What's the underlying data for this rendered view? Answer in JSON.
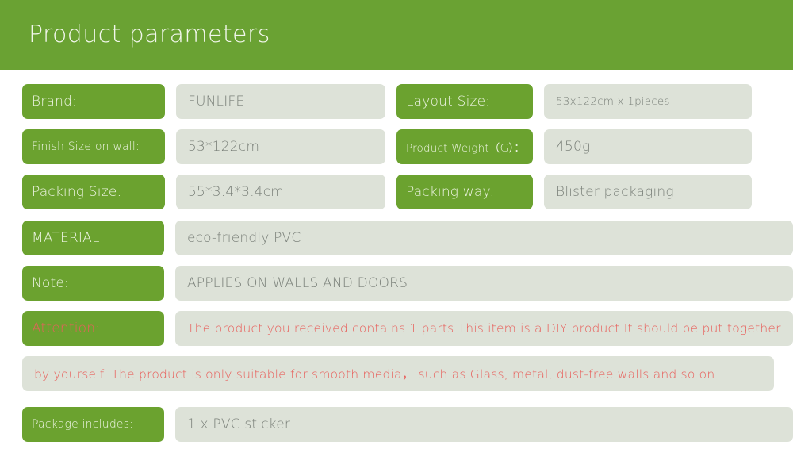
{
  "header": {
    "title": "Product parameters"
  },
  "colors": {
    "header_green": "#6aa233",
    "label_green": "#6ba22f",
    "value_gray": "#dde2d8",
    "value_text": "#7b817a",
    "label_text": "#eef5e4",
    "attention_red": "#e8605c",
    "page_background": "#ffffff"
  },
  "rows": [
    {
      "left": {
        "label": "Brand:",
        "value": "FUNLIFE"
      },
      "right": {
        "label": "Layout Size:",
        "value": "53x122cm x 1pieces"
      }
    },
    {
      "left": {
        "label": "Finish Size on wall:",
        "value": "53*122cm"
      },
      "right": {
        "label": "Product Weight（G）：",
        "value": "450g"
      }
    },
    {
      "left": {
        "label": "Packing Size:",
        "value": "55*3.4*3.4cm"
      },
      "right": {
        "label": "Packing way:",
        "value": "Blister packaging"
      }
    }
  ],
  "wide_rows": [
    {
      "label": "MATERIAL:",
      "value": "eco-friendly PVC"
    },
    {
      "label": "Note:",
      "value": "APPLIES ON WALLS AND DOORS"
    }
  ],
  "attention": {
    "label": "Attention:",
    "line1": "The product you received contains 1 parts.This item is a DIY product.It should be put together",
    "line2": "by yourself. The product is only suitable for smooth media，  such as Glass, metal, dust-free walls and so on."
  },
  "package": {
    "label": "Package includes:",
    "value": "1 x PVC sticker"
  }
}
